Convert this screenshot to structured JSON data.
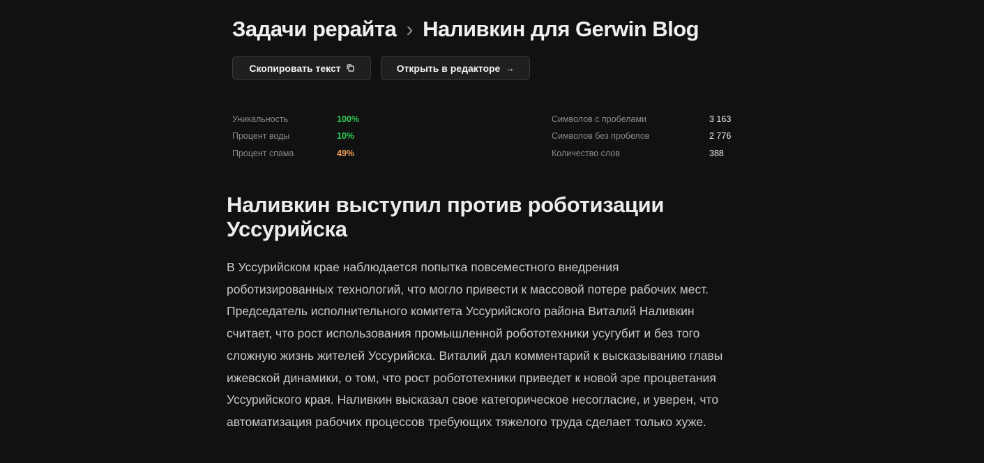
{
  "breadcrumb": {
    "parent": "Задачи рерайта",
    "separator": "›",
    "current": "Наливкин для Gerwin Blog"
  },
  "buttons": {
    "copy": "Скопировать текст",
    "open": "Открыть в редакторе",
    "open_icon": "→"
  },
  "stats_left": [
    {
      "label": "Уникальность",
      "value": "100%",
      "color": "#2ecc52"
    },
    {
      "label": "Процент воды",
      "value": "10%",
      "color": "#2ecc52"
    },
    {
      "label": "Процент спама",
      "value": "49%",
      "color": "#f5a25a"
    }
  ],
  "stats_right": [
    {
      "label": "Символов с пробелами",
      "value": "3 163"
    },
    {
      "label": "Символов без пробелов",
      "value": "2 776"
    },
    {
      "label": "Количество слов",
      "value": "388"
    }
  ],
  "article": {
    "title": "Наливкин выступил против роботизации Уссурийска",
    "body": "В Уссурийском крае наблюдается попытка повсеместного внедрения роботизированных технологий, что могло привести к массовой потере рабочих мест. Председатель исполнительного комитета Уссурийского района Виталий Наливкин считает, что рост использования промышленной робототехники усугубит и без того сложную жизнь жителей Уссурийска. Виталий дал комментарий к высказыванию главы ижевской динамики, о том, что рост робототехники приведет к новой эре процветания Уссурийского края. Наливкин высказал свое категорическое несогласие, и уверен, что автоматизация рабочих процессов требующих тяжелого труда сделает только хуже."
  }
}
